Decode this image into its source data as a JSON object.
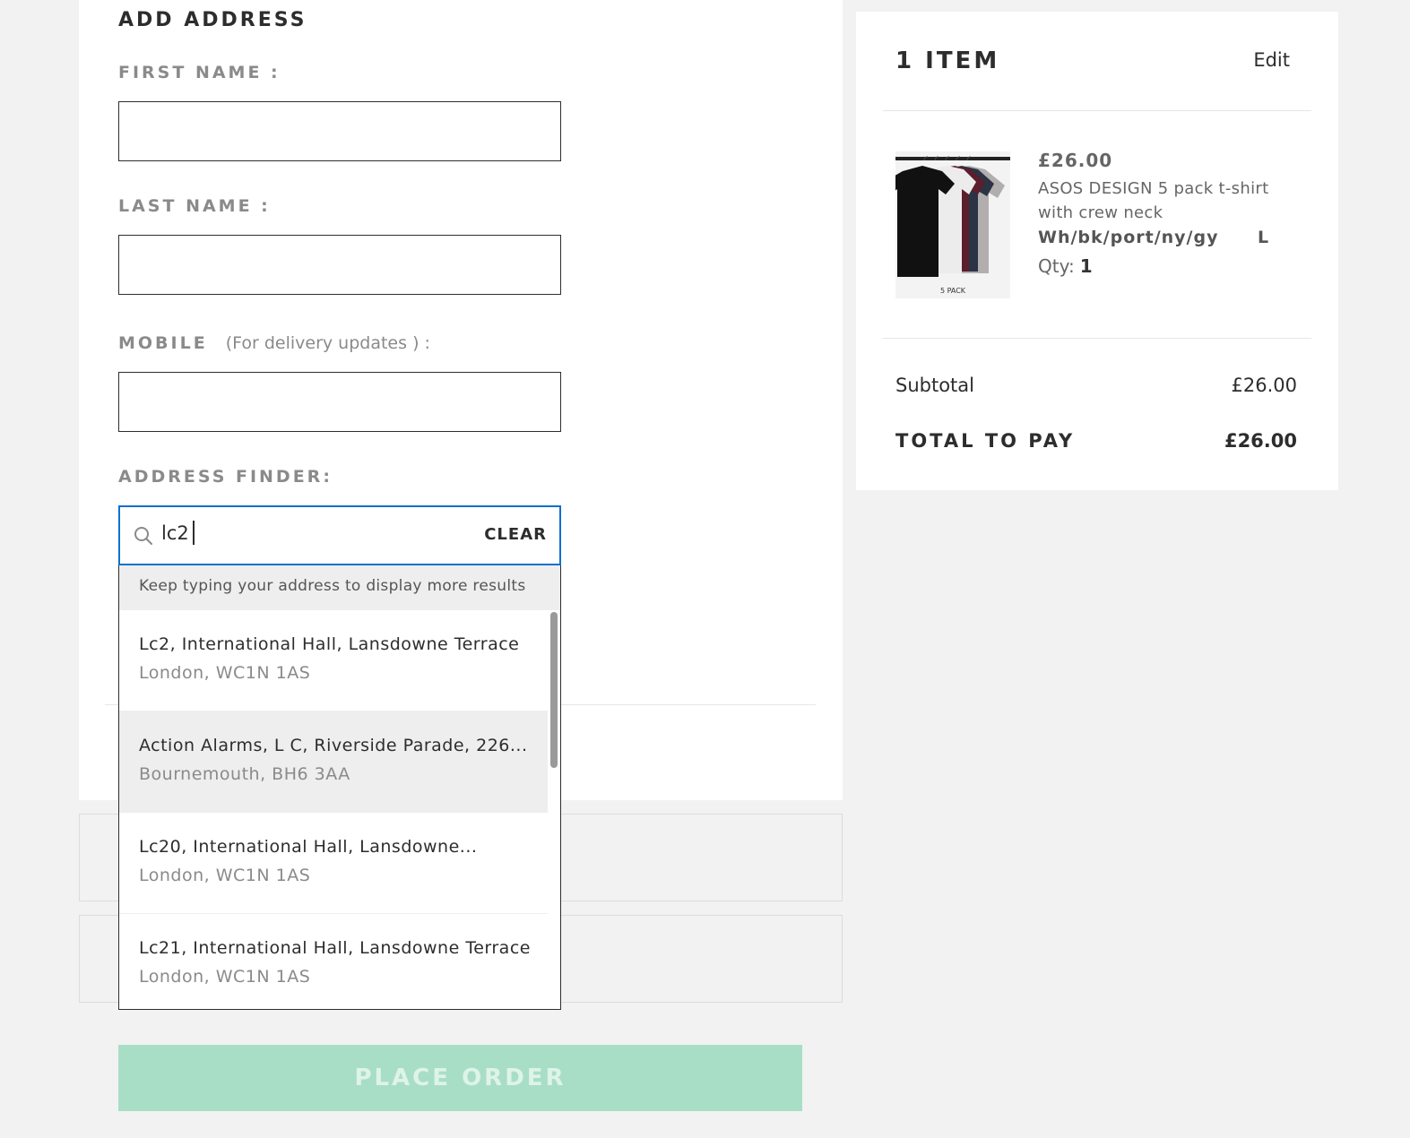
{
  "form": {
    "heading": "ADD ADDRESS",
    "first_name_label": "FIRST NAME :",
    "first_name_value": "",
    "last_name_label": "LAST NAME :",
    "last_name_value": "",
    "mobile_label": "MOBILE",
    "mobile_hint": "(For delivery updates ) :",
    "mobile_value": "",
    "address_finder_label": "ADDRESS FINDER:",
    "address_query": "lc2",
    "clear_label": "CLEAR"
  },
  "suggestions": {
    "tip": "Keep typing your address to display more results",
    "items": [
      {
        "line1": "Lc2, International Hall, Lansdowne Terrace",
        "line2": "London, WC1N 1AS"
      },
      {
        "line1": "Action Alarms, L C, Riverside Parade, 226...",
        "line2": "Bournemouth, BH6 3AA"
      },
      {
        "line1": "Lc20, International Hall, Lansdowne...",
        "line2": "London, WC1N 1AS"
      },
      {
        "line1": "Lc21, International Hall, Lansdowne Terrace",
        "line2": "London, WC1N 1AS"
      }
    ]
  },
  "place_order_label": "PLACE ORDER",
  "summary": {
    "item_count": "1 ITEM",
    "edit_label": "Edit",
    "product": {
      "price": "£26.00",
      "name": "ASOS DESIGN 5 pack t-shirt with crew neck",
      "variant": "Wh/bk/port/ny/gy",
      "size": "L",
      "qty_label": "Qty:",
      "qty": "1",
      "image_caption": "5 PACK"
    },
    "subtotal_label": "Subtotal",
    "subtotal_value": "£26.00",
    "total_label": "TOTAL TO PAY",
    "total_value": "£26.00"
  },
  "colors": {
    "accent_focus": "#0770cf",
    "place_order_bg": "#a9dec6"
  }
}
